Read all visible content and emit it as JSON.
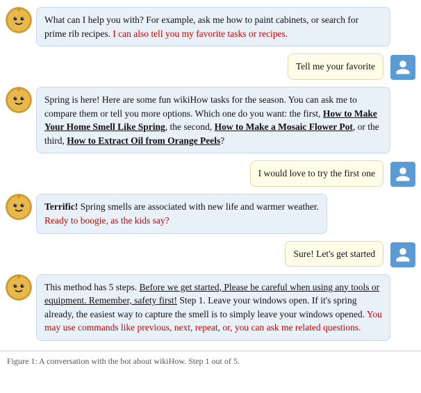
{
  "chat": {
    "messages": [
      {
        "id": "bot1",
        "type": "bot",
        "parts": [
          {
            "text": "What can I help you with?  For example, ask me how to paint cabinets, or search for prime rib recipes. ",
            "style": "normal"
          },
          {
            "text": "I can also tell you my favorite tasks or recipes.",
            "style": "red"
          }
        ]
      },
      {
        "id": "user1",
        "type": "user",
        "parts": [
          {
            "text": "Tell me your favorite",
            "style": "normal"
          }
        ]
      },
      {
        "id": "bot2",
        "type": "bot",
        "parts": [
          {
            "text": "Spring is here! Here are some fun wikiHow tasks for the season. You can ask me to compare them or tell you more options. Which one do you want: the first, ",
            "style": "normal"
          },
          {
            "text": "How to Make Your Home Smell Like Spring",
            "style": "bold-underline"
          },
          {
            "text": ", the second, ",
            "style": "normal"
          },
          {
            "text": "How to Make a Mosaic Flower Pot",
            "style": "bold-underline"
          },
          {
            "text": ", or the third, ",
            "style": "normal"
          },
          {
            "text": "How to Extract Oil from Orange Peels",
            "style": "bold-underline"
          },
          {
            "text": "?",
            "style": "normal"
          }
        ]
      },
      {
        "id": "user2",
        "type": "user",
        "parts": [
          {
            "text": "I would love to try the first one",
            "style": "normal"
          }
        ]
      },
      {
        "id": "bot3",
        "type": "bot",
        "parts": [
          {
            "text": "Terrific!",
            "style": "bold"
          },
          {
            "text": " Spring smells are associated with new life and warmer weather.",
            "style": "normal"
          },
          {
            "text": "\nReady to boogie, as the kids say?",
            "style": "red"
          }
        ]
      },
      {
        "id": "user3",
        "type": "user",
        "parts": [
          {
            "text": "Sure! Let’s get started",
            "style": "normal"
          }
        ]
      },
      {
        "id": "bot4",
        "type": "bot",
        "parts": [
          {
            "text": " This method has 5 steps.  ",
            "style": "normal"
          },
          {
            "text": "Before we get started, Please be careful when using any tools or equipment. Remember, safety first!",
            "style": "underline"
          },
          {
            "text": " Step 1. Leave your windows open. If it’s spring already, the easiest way to capture the smell is to simply leave your windows opened.  ",
            "style": "normal"
          },
          {
            "text": "You may use commands like previous, next, repeat, or, you can ask me related questions.",
            "style": "red"
          }
        ]
      }
    ],
    "bottom_label": "Figure 1: A conversation with the bot about wikiHow. Step 1 out of 5."
  }
}
